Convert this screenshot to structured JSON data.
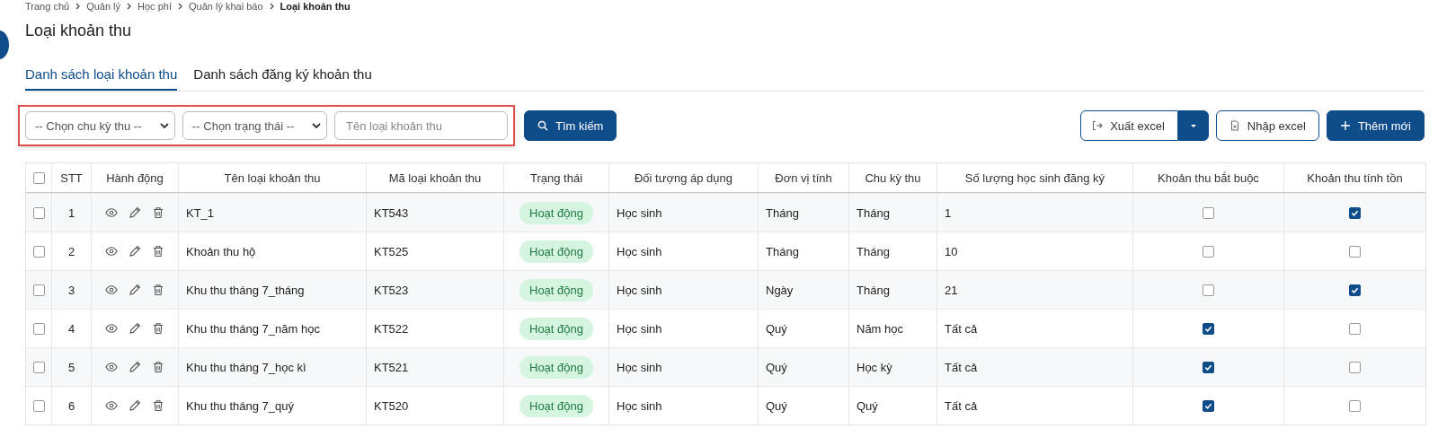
{
  "breadcrumb": [
    "Trang chủ",
    "Quản lý",
    "Học phí",
    "Quản lý khai báo",
    "Loại khoản thu"
  ],
  "page_title": "Loại khoản thu",
  "tabs": [
    {
      "label": "Danh sách loại khoản thu",
      "selected": true
    },
    {
      "label": "Danh sách đăng ký khoản thu",
      "selected": false
    }
  ],
  "filters": {
    "cycle_select": {
      "value": "-- Chọn chu kỳ thu --"
    },
    "status_select": {
      "value": "-- Chọn trạng thái --"
    },
    "name_field": {
      "placeholder": "Tên loại khoản thu"
    },
    "search_button": "Tìm kiếm"
  },
  "actions": {
    "export_button": "Xuất excel",
    "import_button": "Nhập excel",
    "add_button": "Thêm mới"
  },
  "table": {
    "header_checked": false,
    "columns": [
      "STT",
      "Hành động",
      "Tên loại khoản thu",
      "Mã loại khoản thu",
      "Trạng thái",
      "Đối tượng áp dụng",
      "Đơn vị tính",
      "Chu kỳ thu",
      "Số lượng học sinh đăng ký",
      "Khoản thu bắt buộc",
      "Khoản thu tính tồn"
    ],
    "rows": [
      {
        "checked": false,
        "stt": "1",
        "name": "KT_1",
        "code": "KT543",
        "status": "Hoạt động",
        "target": "Học sinh",
        "unit": "Tháng",
        "cycle": "Tháng",
        "count": "1",
        "mandatory": false,
        "carry_over": true
      },
      {
        "checked": false,
        "stt": "2",
        "name": "Khoản thu hộ",
        "code": "KT525",
        "status": "Hoạt động",
        "target": "Học sinh",
        "unit": "Tháng",
        "cycle": "Tháng",
        "count": "10",
        "mandatory": false,
        "carry_over": false
      },
      {
        "checked": false,
        "stt": "3",
        "name": "Khu thu tháng 7_tháng",
        "code": "KT523",
        "status": "Hoạt động",
        "target": "Học sinh",
        "unit": "Ngày",
        "cycle": "Tháng",
        "count": "21",
        "mandatory": false,
        "carry_over": true
      },
      {
        "checked": false,
        "stt": "4",
        "name": "Khu thu tháng 7_năm học",
        "code": "KT522",
        "status": "Hoạt động",
        "target": "Học sinh",
        "unit": "Quý",
        "cycle": "Năm học",
        "count": "Tất cả",
        "mandatory": true,
        "carry_over": false
      },
      {
        "checked": false,
        "stt": "5",
        "name": "Khu thu tháng 7_học kì",
        "code": "KT521",
        "status": "Hoạt động",
        "target": "Học sinh",
        "unit": "Quý",
        "cycle": "Học kỳ",
        "count": "Tất cả",
        "mandatory": true,
        "carry_over": false
      },
      {
        "checked": false,
        "stt": "6",
        "name": "Khu thu tháng 7_quý",
        "code": "KT520",
        "status": "Hoạt động",
        "target": "Học sinh",
        "unit": "Quý",
        "cycle": "Quý",
        "count": "Tất cả",
        "mandatory": true,
        "carry_over": false
      }
    ]
  }
}
